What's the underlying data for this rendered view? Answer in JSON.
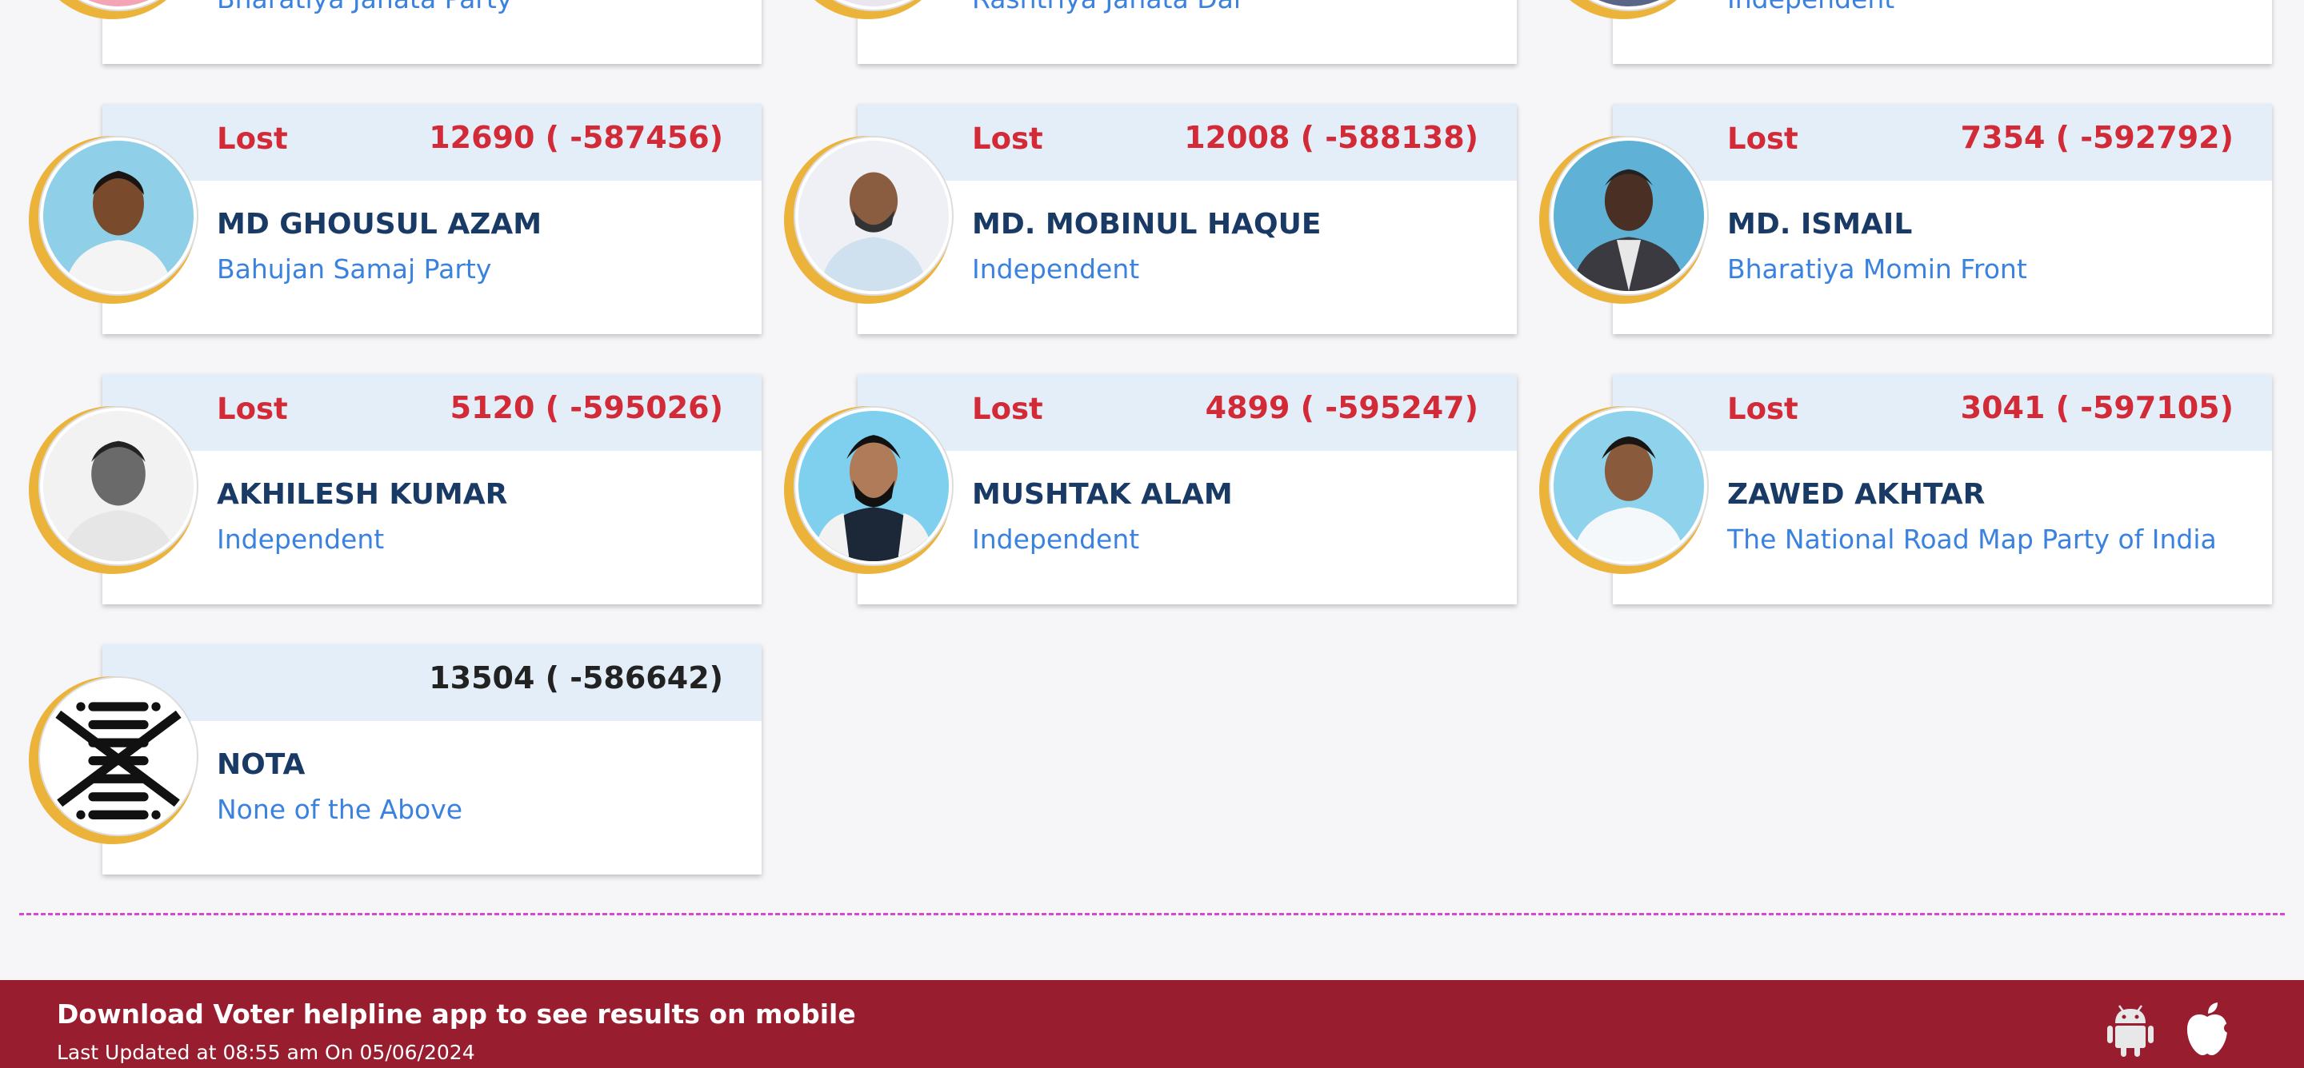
{
  "colors": {
    "lost": "#d22a36",
    "name": "#1a3a66",
    "party": "#3b82df",
    "card_header": "#e3eef9",
    "ring": "#ebb33a",
    "footer": "#981d2f",
    "divider": "#d44ad6"
  },
  "top_row": [
    {
      "party": "Bharatiya Janata Party"
    },
    {
      "party": "Rashtriya Janata Dal"
    },
    {
      "party": "Independent"
    }
  ],
  "candidates": [
    {
      "status": "Lost",
      "votes": "12690 ( -587456)",
      "name": "MD GHOUSUL AZAM",
      "party": "Bahujan Samaj Party",
      "photo": "candidate-photo"
    },
    {
      "status": "Lost",
      "votes": "12008 ( -588138)",
      "name": "MD. MOBINUL HAQUE",
      "party": "Independent",
      "photo": "candidate-photo"
    },
    {
      "status": "Lost",
      "votes": "7354 ( -592792)",
      "name": "MD. ISMAIL",
      "party": "Bharatiya Momin Front",
      "photo": "candidate-photo"
    },
    {
      "status": "Lost",
      "votes": "5120 ( -595026)",
      "name": "AKHILESH KUMAR",
      "party": "Independent",
      "photo": "candidate-photo"
    },
    {
      "status": "Lost",
      "votes": "4899 ( -595247)",
      "name": "MUSHTAK ALAM",
      "party": "Independent",
      "photo": "candidate-photo"
    },
    {
      "status": "Lost",
      "votes": "3041 ( -597105)",
      "name": "ZAWED AKHTAR",
      "party": "The National Road Map Party of India",
      "photo": "candidate-photo"
    },
    {
      "status": "",
      "votes": "13504 ( -586642)",
      "name": "NOTA",
      "party": "None of the Above",
      "photo": "nota-symbol"
    }
  ],
  "footer": {
    "title": "Download Voter helpline app to see results on mobile",
    "updated": "Last Updated at 08:55 am On 05/06/2024",
    "icons": [
      "android-icon",
      "apple-icon"
    ]
  }
}
